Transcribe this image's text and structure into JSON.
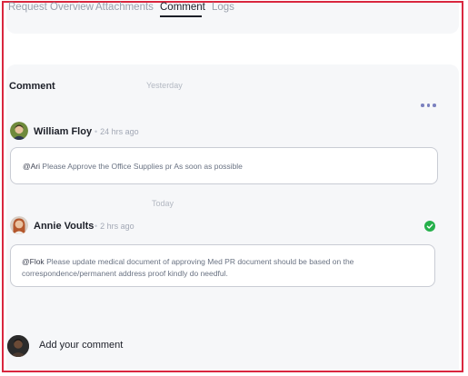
{
  "tabs": [
    {
      "label": "Request Overview"
    },
    {
      "label": "Attachments"
    },
    {
      "label": "Comment"
    },
    {
      "label": "Logs"
    }
  ],
  "active_tab": "Comment",
  "section": {
    "title": "Comment"
  },
  "days": {
    "yesterday": "Yesterday",
    "today": "Today"
  },
  "comments": [
    {
      "author": "William Floy",
      "time": "24 hrs ago",
      "mention": "@Ari",
      "text": "Please Approve the Office Supplies pr As soon as possible",
      "avatar_icon": "user-avatar-william"
    },
    {
      "author": "Annie Voults",
      "time": "2 hrs ago",
      "mention": "@Flok",
      "text": "Please update medical document of approving Med PR document should be based on the correspondence/permanent address proof kindly do needful.",
      "avatar_icon": "user-avatar-annie",
      "status_icon": "check-circle-icon"
    }
  ],
  "composer": {
    "label": "Add your comment"
  },
  "colors": {
    "frame_border": "#d9273f",
    "check_green": "#25b04b",
    "menu_dots": "#7b81bf"
  }
}
